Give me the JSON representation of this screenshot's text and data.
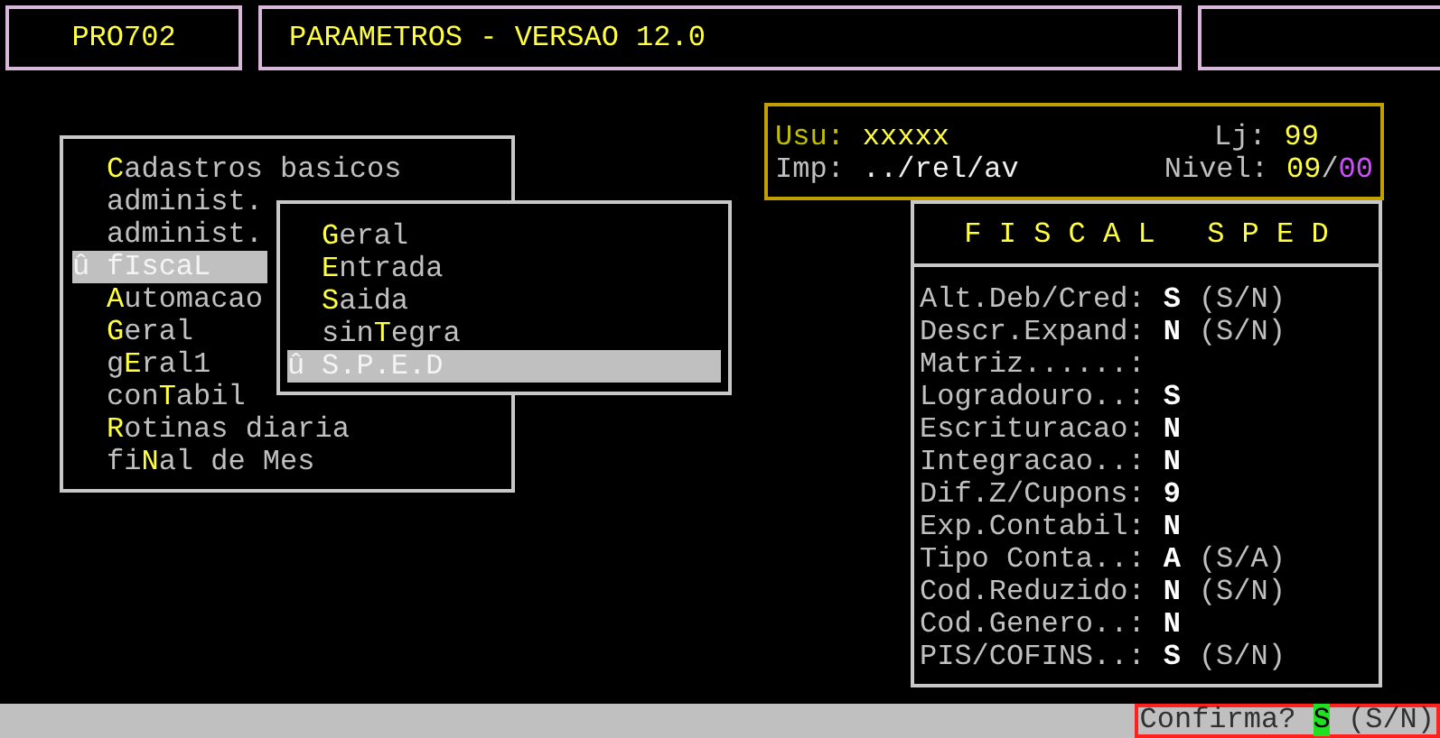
{
  "header": {
    "program_code": "PRO702",
    "title": "PARAMETROS - VERSAO 12.0"
  },
  "menu": {
    "items": [
      {
        "label": "**C**adastros basicos",
        "selected": false
      },
      {
        "label": "administ.",
        "selected": false
      },
      {
        "label": "administ.",
        "selected": false
      },
      {
        "label": "f**I**scaL",
        "selected": true,
        "marker": "û"
      },
      {
        "label": "**A**utomacao",
        "selected": false
      },
      {
        "label": "**G**eral",
        "selected": false
      },
      {
        "label": "g**E**ral1",
        "selected": false
      },
      {
        "label": "con**T**abil",
        "selected": false
      },
      {
        "label": "**R**otinas diaria",
        "selected": false
      },
      {
        "label": "fi**N**al de Mes",
        "selected": false
      }
    ]
  },
  "submenu": {
    "items": [
      {
        "label": "**G**eral",
        "selected": false
      },
      {
        "label": "**E**ntrada",
        "selected": false
      },
      {
        "label": "**S**aida",
        "selected": false
      },
      {
        "label": "sin**T**egra",
        "selected": false
      },
      {
        "label": "S.P.E.D",
        "selected": true,
        "marker": "û"
      }
    ]
  },
  "session": {
    "user_label": "Usu:",
    "user": "xxxxx",
    "store_label": "Lj:",
    "store": "99",
    "printer_label": "Imp:",
    "printer": "../rel/av",
    "level_label": "Nivel:",
    "level_value": "**09**/*00*"
  },
  "fiscal_panel": {
    "title": "F I S C A L   S P E D",
    "fields": [
      {
        "label": "Alt.Deb/Cred:",
        "value": "S",
        "hint": "(S/N)"
      },
      {
        "label": "Descr.Expand:",
        "value": "N",
        "hint": "(S/N)"
      },
      {
        "label": "Matriz......:"
      },
      {
        "label": "Logradouro..:",
        "value": "S"
      },
      {
        "label": "Escrituracao:",
        "value": "N"
      },
      {
        "label": "Integracao..:",
        "value": "N"
      },
      {
        "label": "Dif.Z/Cupons:",
        "value": "9"
      },
      {
        "label": "Exp.Contabil:",
        "value": "N"
      },
      {
        "label": "Tipo Conta..:",
        "value": "A",
        "hint": "(S/A)"
      },
      {
        "label": "Cod.Reduzido:",
        "value": "N",
        "hint": "(S/N)"
      },
      {
        "label": "Cod.Genero..:",
        "value": "N"
      },
      {
        "label": "PIS/COFINS..:",
        "value": "S",
        "hint": "(S/N)"
      }
    ]
  },
  "status_bar": {
    "prompt": "Confirma? **S** (S/N)"
  }
}
